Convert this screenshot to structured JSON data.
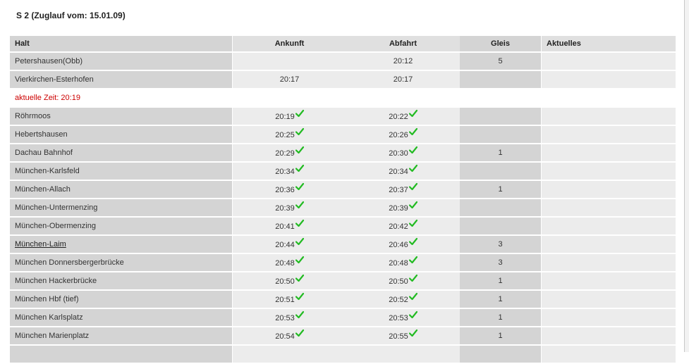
{
  "page": {
    "title": "S 2 (Zuglauf vom: 15.01.09)"
  },
  "table": {
    "headers": {
      "halt": "Halt",
      "ankunft": "Ankunft",
      "abfahrt": "Abfahrt",
      "gleis": "Gleis",
      "aktuelles": "Aktuelles"
    },
    "current_time": "aktuelle Zeit: 20:19",
    "rows_before": [
      {
        "halt": "Petershausen(Obb)",
        "ankunft": "",
        "abfahrt": "20:12",
        "gleis": "5",
        "aktuelles": ""
      },
      {
        "halt": "Vierkirchen-Esterhofen",
        "ankunft": "20:17",
        "abfahrt": "20:17",
        "gleis": "",
        "aktuelles": ""
      }
    ],
    "rows_after": [
      {
        "halt": "Röhrmoos",
        "ankunft": "20:19",
        "abfahrt": "20:22",
        "gleis": "",
        "aktuelles": ""
      },
      {
        "halt": "Hebertshausen",
        "ankunft": "20:25",
        "abfahrt": "20:26",
        "gleis": "",
        "aktuelles": ""
      },
      {
        "halt": "Dachau Bahnhof",
        "ankunft": "20:29",
        "abfahrt": "20:30",
        "gleis": "1",
        "aktuelles": ""
      },
      {
        "halt": "München-Karlsfeld",
        "ankunft": "20:34",
        "abfahrt": "20:34",
        "gleis": "",
        "aktuelles": ""
      },
      {
        "halt": "München-Allach",
        "ankunft": "20:36",
        "abfahrt": "20:37",
        "gleis": "1",
        "aktuelles": ""
      },
      {
        "halt": "München-Untermenzing",
        "ankunft": "20:39",
        "abfahrt": "20:39",
        "gleis": "",
        "aktuelles": ""
      },
      {
        "halt": "München-Obermenzing",
        "ankunft": "20:41",
        "abfahrt": "20:42",
        "gleis": "",
        "aktuelles": ""
      },
      {
        "halt": "München-Laim",
        "ankunft": "20:44",
        "abfahrt": "20:46",
        "gleis": "3",
        "aktuelles": "",
        "link": true
      },
      {
        "halt": "München Donnersbergerbrücke",
        "ankunft": "20:48",
        "abfahrt": "20:48",
        "gleis": "3",
        "aktuelles": ""
      },
      {
        "halt": "München Hackerbrücke",
        "ankunft": "20:50",
        "abfahrt": "20:50",
        "gleis": "1",
        "aktuelles": ""
      },
      {
        "halt": "München Hbf (tief)",
        "ankunft": "20:51",
        "abfahrt": "20:52",
        "gleis": "1",
        "aktuelles": ""
      },
      {
        "halt": "München Karlsplatz",
        "ankunft": "20:53",
        "abfahrt": "20:53",
        "gleis": "1",
        "aktuelles": ""
      },
      {
        "halt": "München Marienplatz",
        "ankunft": "20:54",
        "abfahrt": "20:55",
        "gleis": "1",
        "aktuelles": ""
      },
      {
        "halt": "",
        "ankunft": "",
        "abfahrt": "",
        "gleis": "",
        "aktuelles": ""
      }
    ]
  },
  "icons": {
    "on_time": "check-icon"
  },
  "colors": {
    "check": "#22bb22",
    "current_time": "#cc0000",
    "halt_bg": "#d4d4d4",
    "cell_bg": "#ececec"
  }
}
